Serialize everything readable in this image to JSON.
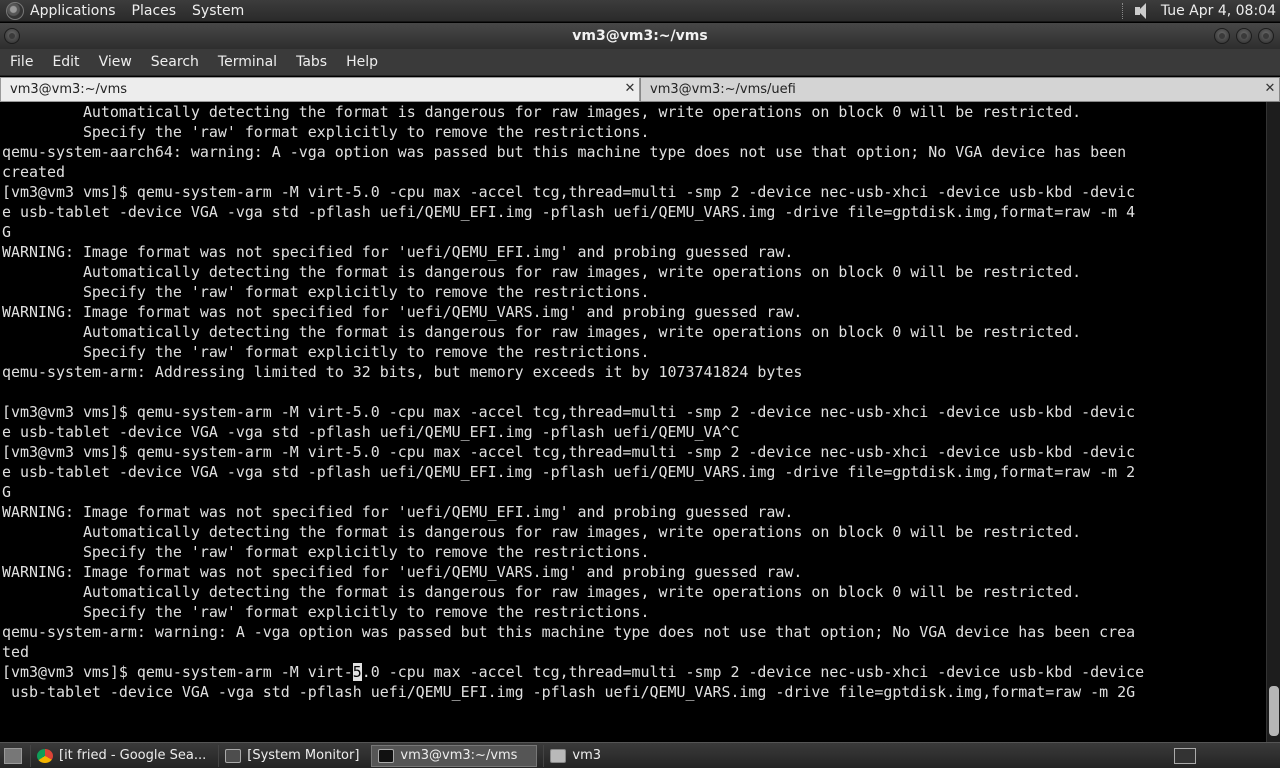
{
  "top_panel": {
    "menus": [
      "Applications",
      "Places",
      "System"
    ],
    "clock": "Tue Apr  4, 08:04"
  },
  "window": {
    "title": "vm3@vm3:~/vms"
  },
  "menubar": [
    "File",
    "Edit",
    "View",
    "Search",
    "Terminal",
    "Tabs",
    "Help"
  ],
  "tabs": [
    {
      "label": "vm3@vm3:~/vms",
      "active": true
    },
    {
      "label": "vm3@vm3:~/vms/uefi",
      "active": false
    }
  ],
  "terminal": {
    "lines": [
      "         Automatically detecting the format is dangerous for raw images, write operations on block 0 will be restricted.",
      "         Specify the 'raw' format explicitly to remove the restrictions.",
      "qemu-system-aarch64: warning: A -vga option was passed but this machine type does not use that option; No VGA device has been",
      "created",
      "[vm3@vm3 vms]$ qemu-system-arm -M virt-5.0 -cpu max -accel tcg,thread=multi -smp 2 -device nec-usb-xhci -device usb-kbd -devic",
      "e usb-tablet -device VGA -vga std -pflash uefi/QEMU_EFI.img -pflash uefi/QEMU_VARS.img -drive file=gptdisk.img,format=raw -m 4",
      "G",
      "WARNING: Image format was not specified for 'uefi/QEMU_EFI.img' and probing guessed raw.",
      "         Automatically detecting the format is dangerous for raw images, write operations on block 0 will be restricted.",
      "         Specify the 'raw' format explicitly to remove the restrictions.",
      "WARNING: Image format was not specified for 'uefi/QEMU_VARS.img' and probing guessed raw.",
      "         Automatically detecting the format is dangerous for raw images, write operations on block 0 will be restricted.",
      "         Specify the 'raw' format explicitly to remove the restrictions.",
      "qemu-system-arm: Addressing limited to 32 bits, but memory exceeds it by 1073741824 bytes",
      "",
      "[vm3@vm3 vms]$ qemu-system-arm -M virt-5.0 -cpu max -accel tcg,thread=multi -smp 2 -device nec-usb-xhci -device usb-kbd -devic",
      "e usb-tablet -device VGA -vga std -pflash uefi/QEMU_EFI.img -pflash uefi/QEMU_VA^C",
      "[vm3@vm3 vms]$ qemu-system-arm -M virt-5.0 -cpu max -accel tcg,thread=multi -smp 2 -device nec-usb-xhci -device usb-kbd -devic",
      "e usb-tablet -device VGA -vga std -pflash uefi/QEMU_EFI.img -pflash uefi/QEMU_VARS.img -drive file=gptdisk.img,format=raw -m 2",
      "G",
      "WARNING: Image format was not specified for 'uefi/QEMU_EFI.img' and probing guessed raw.",
      "         Automatically detecting the format is dangerous for raw images, write operations on block 0 will be restricted.",
      "         Specify the 'raw' format explicitly to remove the restrictions.",
      "WARNING: Image format was not specified for 'uefi/QEMU_VARS.img' and probing guessed raw.",
      "         Automatically detecting the format is dangerous for raw images, write operations on block 0 will be restricted.",
      "         Specify the 'raw' format explicitly to remove the restrictions.",
      "qemu-system-arm: warning: A -vga option was passed but this machine type does not use that option; No VGA device has been crea",
      "ted"
    ],
    "prompt_line_before_cursor": "[vm3@vm3 vms]$ qemu-system-arm -M virt-",
    "cursor_char": "5",
    "prompt_line_after_cursor": ".0 -cpu max -accel tcg,thread=multi -smp 2 -device nec-usb-xhci -device usb-kbd -device",
    "prompt_continuation": " usb-tablet -device VGA -vga std -pflash uefi/QEMU_EFI.img -pflash uefi/QEMU_VARS.img -drive file=gptdisk.img,format=raw -m 2G"
  },
  "taskbar": {
    "items": [
      {
        "label": "[it fried - Google Sea...",
        "icon": "chrome-icon"
      },
      {
        "label": "[System Monitor]",
        "icon": "system-monitor-icon"
      },
      {
        "label": "vm3@vm3:~/vms",
        "icon": "terminal-icon"
      },
      {
        "label": "vm3",
        "icon": "folder-icon"
      }
    ]
  }
}
